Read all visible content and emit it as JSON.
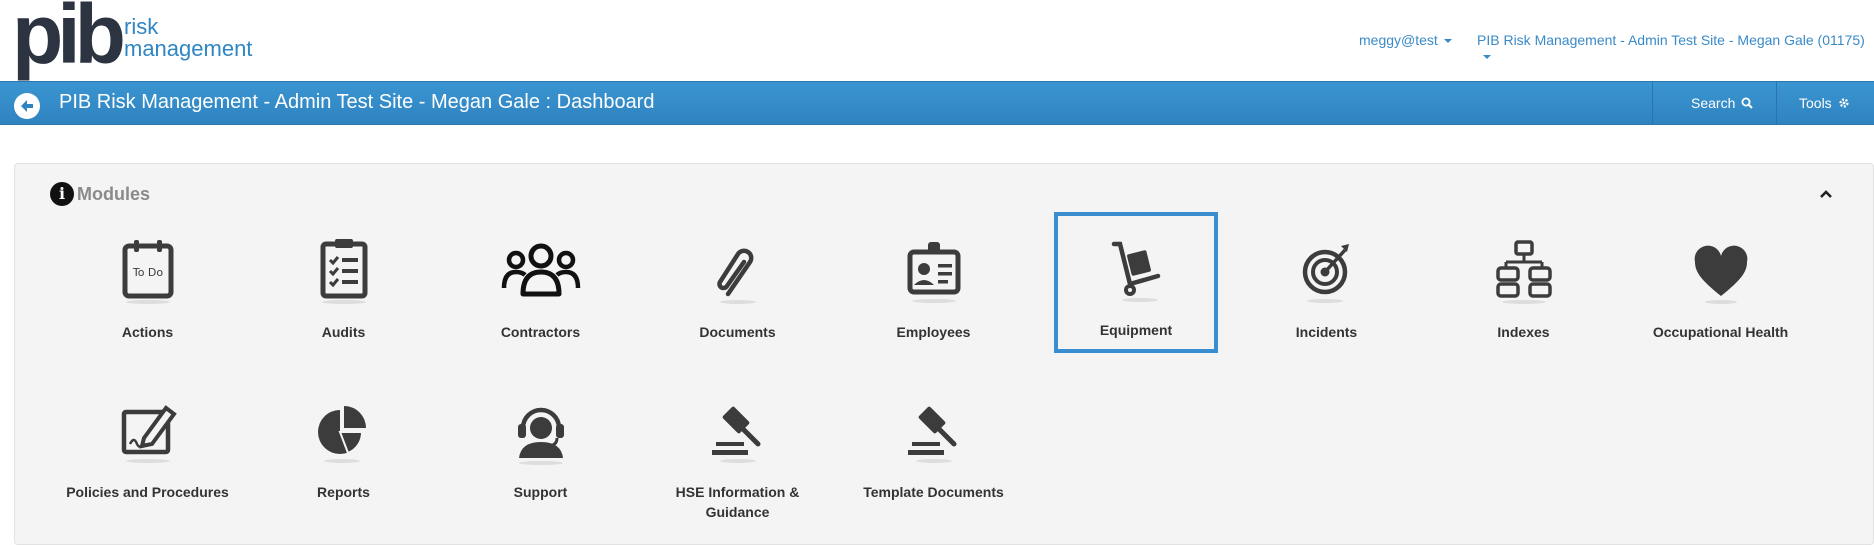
{
  "brand": {
    "logo_main": "pib",
    "logo_line1": "risk",
    "logo_line2": "management"
  },
  "header": {
    "user_menu": "meggy@test",
    "site_menu": "PIB Risk Management - Admin Test Site - Megan Gale (01175)"
  },
  "navbar": {
    "title": "PIB Risk Management - Admin Test Site - Megan Gale : Dashboard",
    "search_label": "Search",
    "tools_label": "Tools"
  },
  "modules": {
    "title": "Modules",
    "items": [
      {
        "label": "Actions",
        "icon": "todo-calendar-icon"
      },
      {
        "label": "Audits",
        "icon": "checklist-clipboard-icon"
      },
      {
        "label": "Contractors",
        "icon": "people-group-icon"
      },
      {
        "label": "Documents",
        "icon": "paperclip-icon"
      },
      {
        "label": "Employees",
        "icon": "id-badge-icon"
      },
      {
        "label": "Equipment",
        "icon": "hand-truck-icon",
        "selected": true
      },
      {
        "label": "Incidents",
        "icon": "target-icon"
      },
      {
        "label": "Indexes",
        "icon": "hierarchy-icon"
      },
      {
        "label": "Occupational Health",
        "icon": "heart-icon"
      },
      {
        "label": "Policies and Procedures",
        "icon": "signed-document-icon"
      },
      {
        "label": "Reports",
        "icon": "pie-chart-icon"
      },
      {
        "label": "Support",
        "icon": "headset-icon"
      },
      {
        "label": "HSE Information & Guidance",
        "icon": "gavel-icon"
      },
      {
        "label": "Template Documents",
        "icon": "gavel-icon"
      }
    ]
  },
  "colors": {
    "primary": "#3a8ec8",
    "selected_border": "#3a8ed0",
    "icon": "#3c3c3c"
  }
}
